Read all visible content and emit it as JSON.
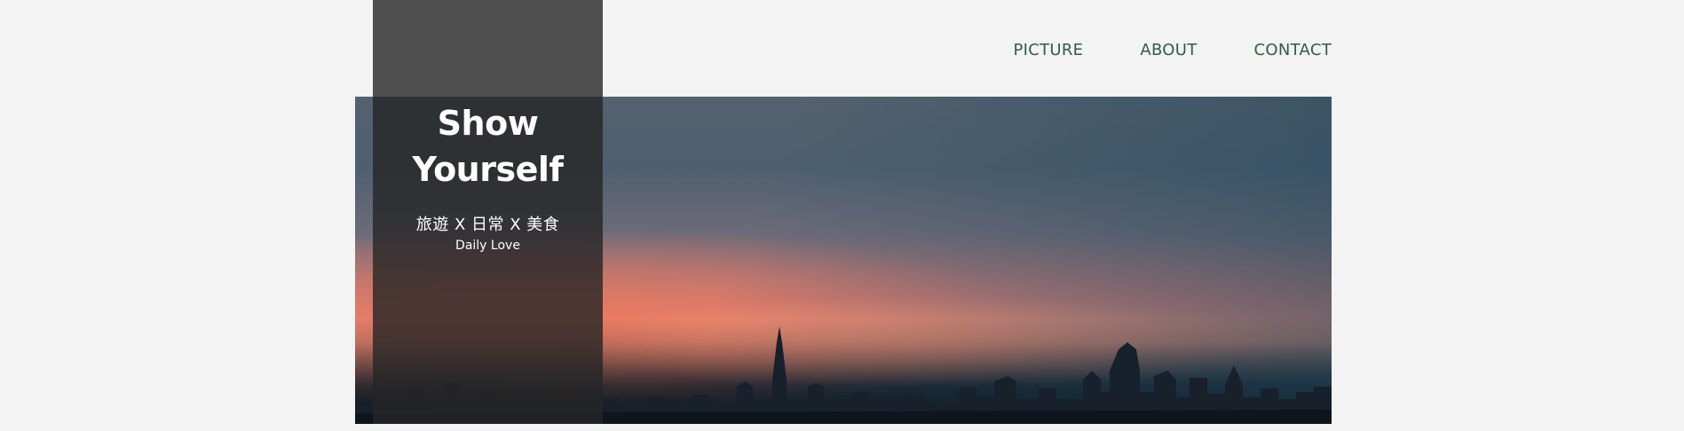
{
  "nav": {
    "items": [
      {
        "label": "PICTURE"
      },
      {
        "label": "ABOUT"
      },
      {
        "label": "CONTACT"
      }
    ]
  },
  "hero": {
    "title_line1": "Show",
    "title_line2": "Yourself",
    "subtitle": "旅遊 X 日常 X 美食",
    "tagline": "Daily Love"
  },
  "colors": {
    "background": "#f3f3f3",
    "nav_text": "#2f5e45",
    "panel": "rgba(38,38,38,0.8)",
    "panel_text": "#ffffff"
  }
}
